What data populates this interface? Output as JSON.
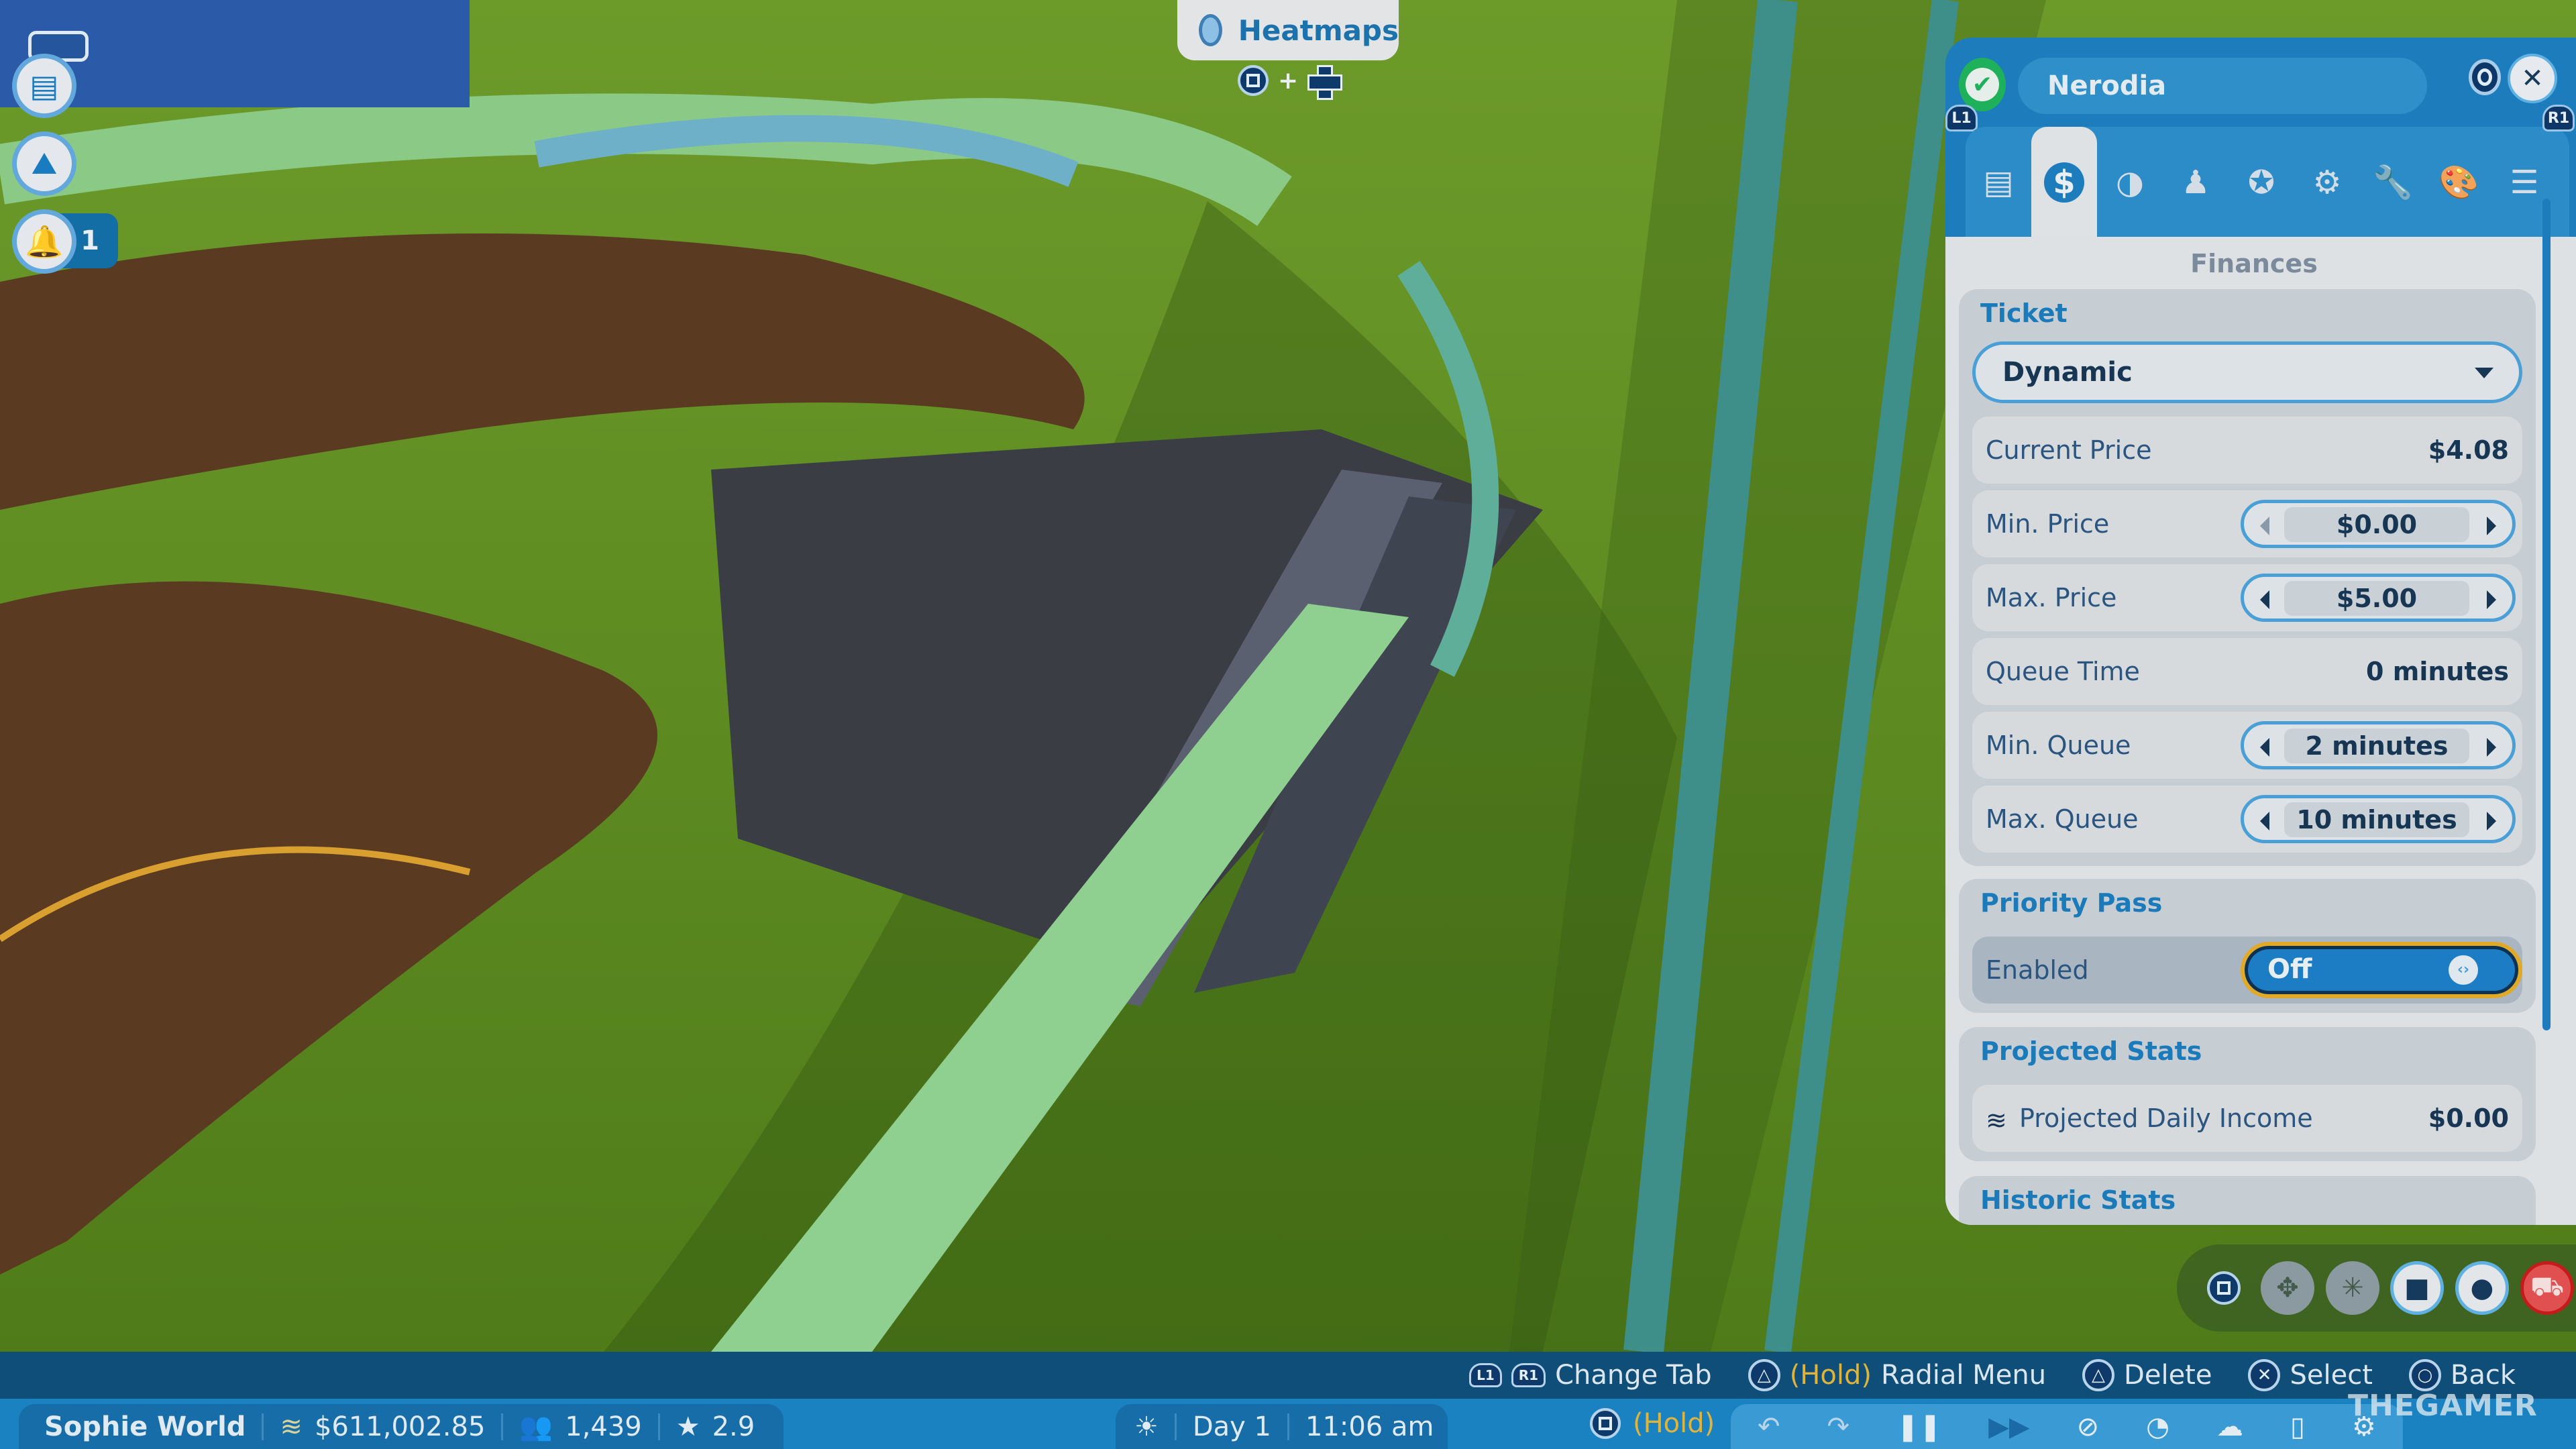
{
  "heatmaps": {
    "label": "Heatmaps",
    "hint_plus": "+",
    "icon": "heatmap-icon"
  },
  "left_toolbar": {
    "items": [
      {
        "icon": "clipboard-icon",
        "glyph": "▤"
      },
      {
        "icon": "terrain-add-icon",
        "glyph": "⛰"
      },
      {
        "icon": "bell-icon",
        "glyph": "🔔"
      }
    ],
    "notification_count": "1"
  },
  "ride_panel": {
    "name": "Nerodia",
    "status": "open",
    "close_glyph": "✕",
    "check_glyph": "✔",
    "tab_prev": "L1",
    "tab_next": "R1",
    "tabs": [
      {
        "icon": "clipboard-icon",
        "glyph": "▤",
        "active": false
      },
      {
        "icon": "dollar-icon",
        "glyph": "$",
        "active": true
      },
      {
        "icon": "ride-stats-icon",
        "glyph": "◑",
        "active": false
      },
      {
        "icon": "staff-icon",
        "glyph": "♟",
        "active": false
      },
      {
        "icon": "star-rating-icon",
        "glyph": "✪",
        "active": false
      },
      {
        "icon": "gear-icon",
        "glyph": "⚙",
        "active": false
      },
      {
        "icon": "wrench-icon",
        "glyph": "🔧",
        "active": false
      },
      {
        "icon": "palette-icon",
        "glyph": "🎨",
        "active": false
      },
      {
        "icon": "list-icon",
        "glyph": "☰",
        "active": false
      }
    ],
    "section_title": "Finances",
    "ticket": {
      "heading": "Ticket",
      "mode": "Dynamic",
      "current_price_label": "Current Price",
      "current_price": "$4.08",
      "min_price_label": "Min. Price",
      "min_price": "$0.00",
      "max_price_label": "Max. Price",
      "max_price": "$5.00",
      "queue_time_label": "Queue Time",
      "queue_time": "0 minutes",
      "min_queue_label": "Min. Queue",
      "min_queue": "2 minutes",
      "max_queue_label": "Max. Queue",
      "max_queue": "10 minutes"
    },
    "priority_pass": {
      "heading": "Priority Pass",
      "enabled_label": "Enabled",
      "state": "Off",
      "knob": "‹›"
    },
    "projected_stats": {
      "heading": "Projected Stats",
      "daily_income_label": "Projected Daily Income",
      "daily_income": "$0.00"
    },
    "historic_stats": {
      "heading": "Historic Stats"
    }
  },
  "quick_actions": [
    {
      "icon": "square-button-icon"
    },
    {
      "icon": "move-icon",
      "glyph": "✥"
    },
    {
      "icon": "expand-icon",
      "glyph": "✳"
    },
    {
      "icon": "camera-icon",
      "glyph": "■"
    },
    {
      "icon": "locate-pin-icon",
      "glyph": "●"
    },
    {
      "icon": "demolish-icon",
      "glyph": "⛟"
    }
  ],
  "controls_hint": [
    {
      "buttons": [
        "L1",
        "R1"
      ],
      "label": "Change Tab"
    },
    {
      "button": "△",
      "hold": "(Hold)",
      "label": "Radial Menu"
    },
    {
      "button": "△",
      "label": "Delete"
    },
    {
      "button": "✕",
      "label": "Select"
    },
    {
      "button": "○",
      "label": "Back"
    }
  ],
  "status_bar": {
    "park_name": "Sophie World",
    "money": "$611,002.85",
    "guests": "1,439",
    "rating": "2.9",
    "day": "Day 1",
    "time": "11:06 am",
    "hold_label": "(Hold)"
  },
  "game_controls": [
    {
      "icon": "undo-icon",
      "glyph": "↶"
    },
    {
      "icon": "redo-icon",
      "glyph": "↷"
    },
    {
      "icon": "pause-icon",
      "glyph": "❚❚"
    },
    {
      "icon": "fast-forward-icon",
      "glyph": "▶▶"
    },
    {
      "icon": "camera-off-icon",
      "glyph": "⊘"
    },
    {
      "icon": "speed-dial-icon",
      "glyph": "◔"
    },
    {
      "icon": "weather-icon",
      "glyph": "☁"
    },
    {
      "icon": "mouse-icon",
      "glyph": "▯"
    },
    {
      "icon": "settings-icon",
      "glyph": "⚙"
    }
  ],
  "watermark": "THEGAMER"
}
